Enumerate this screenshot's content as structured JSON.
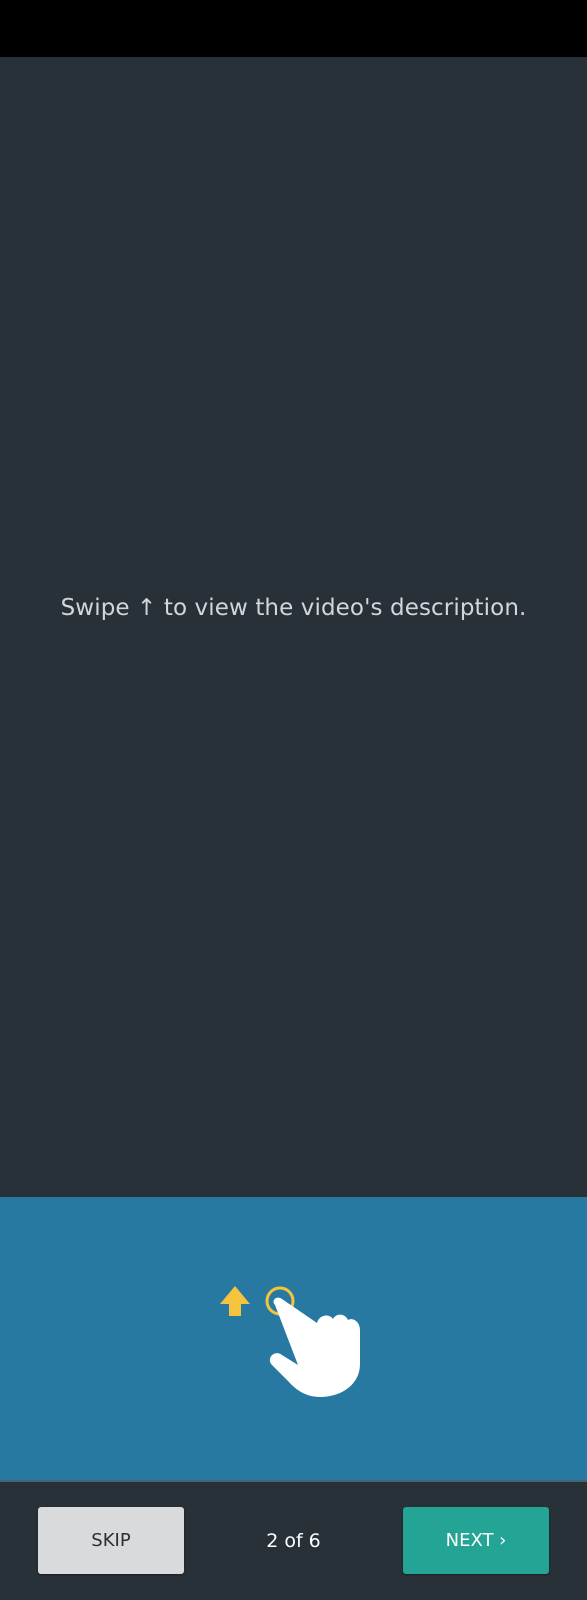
{
  "tutorial": {
    "instruction": "Swipe ↑ to view the video's description.",
    "gesture_icons": [
      "arrow-up-icon",
      "tap-point-icon",
      "pointing-hand-icon"
    ],
    "accent_color": "#f6c33c",
    "panel_color": "#2779a2",
    "background_color": "#283038"
  },
  "footer": {
    "skip_label": "SKIP",
    "page_indicator": "2 of 6",
    "next_label": "NEXT ›",
    "next_color": "#23a494",
    "skip_color": "#d9dadb"
  }
}
